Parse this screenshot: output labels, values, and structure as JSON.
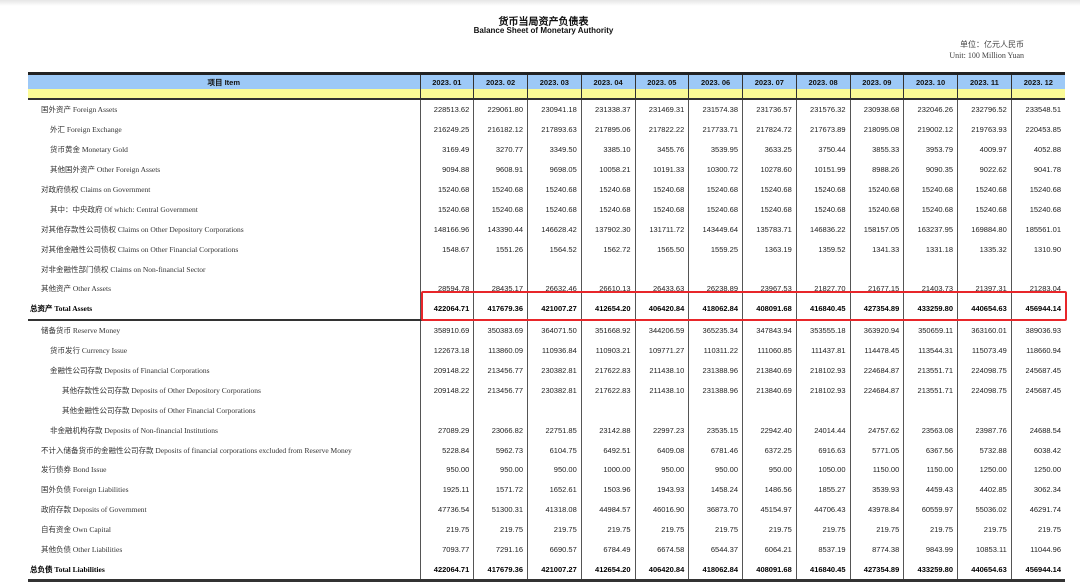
{
  "title_cn": "货币当局资产负债表",
  "title_en": "Balance Sheet of  Monetary Authority",
  "unit_cn": "单位：亿元人民币",
  "unit_en": "Unit: 100 Million Yuan",
  "header": {
    "item": "项目 Item",
    "months": [
      "2023. 01",
      "2023. 02",
      "2023. 03",
      "2023. 04",
      "2023. 05",
      "2023. 06",
      "2023. 07",
      "2023. 08",
      "2023. 09",
      "2023. 10",
      "2023. 11",
      "2023. 12"
    ]
  },
  "highlight_color": "#e8262a",
  "rows": [
    {
      "label": "国外资产  Foreign Assets",
      "level": 1,
      "values": [
        "228513.62",
        "229061.80",
        "230941.18",
        "231338.37",
        "231469.31",
        "231574.38",
        "231736.57",
        "231576.32",
        "230938.68",
        "232046.26",
        "232796.52",
        "233548.51"
      ]
    },
    {
      "label": "外汇  Foreign Exchange",
      "level": 2,
      "values": [
        "216249.25",
        "216182.12",
        "217893.63",
        "217895.06",
        "217822.22",
        "217733.71",
        "217824.72",
        "217673.89",
        "218095.08",
        "219002.12",
        "219763.93",
        "220453.85"
      ]
    },
    {
      "label": "货币黄金  Monetary Gold",
      "level": 2,
      "values": [
        "3169.49",
        "3270.77",
        "3349.50",
        "3385.10",
        "3455.76",
        "3539.95",
        "3633.25",
        "3750.44",
        "3855.33",
        "3953.79",
        "4009.97",
        "4052.88"
      ]
    },
    {
      "label": "其他国外资产  Other Foreign Assets",
      "level": 2,
      "values": [
        "9094.88",
        "9608.91",
        "9698.05",
        "10058.21",
        "10191.33",
        "10300.72",
        "10278.60",
        "10151.99",
        "8988.26",
        "9090.35",
        "9022.62",
        "9041.78"
      ]
    },
    {
      "label": "对政府债权  Claims on Government",
      "level": 1,
      "values": [
        "15240.68",
        "15240.68",
        "15240.68",
        "15240.68",
        "15240.68",
        "15240.68",
        "15240.68",
        "15240.68",
        "15240.68",
        "15240.68",
        "15240.68",
        "15240.68"
      ]
    },
    {
      "label": "其中：中央政府  Of which: Central Government",
      "level": 2,
      "values": [
        "15240.68",
        "15240.68",
        "15240.68",
        "15240.68",
        "15240.68",
        "15240.68",
        "15240.68",
        "15240.68",
        "15240.68",
        "15240.68",
        "15240.68",
        "15240.68"
      ]
    },
    {
      "label": "对其他存款性公司债权  Claims on Other Depository Corporations",
      "level": 1,
      "values": [
        "148166.96",
        "143390.44",
        "146628.42",
        "137902.30",
        "131711.72",
        "143449.64",
        "135783.71",
        "146836.22",
        "158157.05",
        "163237.95",
        "169884.80",
        "185561.01"
      ]
    },
    {
      "label": "对其他金融性公司债权  Claims on Other Financial Corporations",
      "level": 1,
      "values": [
        "1548.67",
        "1551.26",
        "1564.52",
        "1562.72",
        "1565.50",
        "1559.25",
        "1363.19",
        "1359.52",
        "1341.33",
        "1331.18",
        "1335.32",
        "1310.90"
      ]
    },
    {
      "label": "对非金融性部门债权  Claims on Non-financial Sector",
      "level": 1,
      "values": [
        "",
        "",
        "",
        "",
        "",
        "",
        "",
        "",
        "",
        "",
        "",
        ""
      ]
    },
    {
      "label": "其他资产  Other Assets",
      "level": 1,
      "values": [
        "28594.78",
        "28435.17",
        "26632.46",
        "26610.13",
        "26433.63",
        "26238.89",
        "23967.53",
        "21827.70",
        "21677.15",
        "21403.73",
        "21397.31",
        "21283.04"
      ]
    },
    {
      "label": "总资产  Total Assets",
      "level": 0,
      "total": "ta",
      "values": [
        "422064.71",
        "417679.36",
        "421007.27",
        "412654.20",
        "406420.84",
        "418062.84",
        "408091.68",
        "416840.45",
        "427354.89",
        "433259.80",
        "440654.63",
        "456944.14"
      ]
    },
    {
      "label": "储备货币  Reserve Money",
      "level": 1,
      "values": [
        "358910.69",
        "350383.69",
        "364071.50",
        "351668.92",
        "344206.59",
        "365235.34",
        "347843.94",
        "353555.18",
        "363920.94",
        "350659.11",
        "363160.01",
        "389036.93"
      ]
    },
    {
      "label": "货币发行  Currency Issue",
      "level": 2,
      "values": [
        "122673.18",
        "113860.09",
        "110936.84",
        "110903.21",
        "109771.27",
        "110311.22",
        "111060.85",
        "111437.81",
        "114478.45",
        "113544.31",
        "115073.49",
        "118660.94"
      ]
    },
    {
      "label": "金融性公司存款  Deposits of  Financial Corporations",
      "level": 2,
      "values": [
        "209148.22",
        "213456.77",
        "230382.81",
        "217622.83",
        "211438.10",
        "231388.96",
        "213840.69",
        "218102.93",
        "224684.87",
        "213551.71",
        "224098.75",
        "245687.45"
      ]
    },
    {
      "label": "其他存款性公司存款  Deposits of  Other Depository Corporations",
      "level": 3,
      "values": [
        "209148.22",
        "213456.77",
        "230382.81",
        "217622.83",
        "211438.10",
        "231388.96",
        "213840.69",
        "218102.93",
        "224684.87",
        "213551.71",
        "224098.75",
        "245687.45"
      ]
    },
    {
      "label": "其他金融性公司存款  Deposits of  Other Financial Corporations",
      "level": 3,
      "values": [
        "",
        "",
        "",
        "",
        "",
        "",
        "",
        "",
        "",
        "",
        "",
        ""
      ]
    },
    {
      "label": "非金融机构存款 Deposits of  Non-financial Institutions",
      "level": 2,
      "values": [
        "27089.29",
        "23066.82",
        "22751.85",
        "23142.88",
        "22997.23",
        "23535.15",
        "22942.40",
        "24014.44",
        "24757.62",
        "23563.08",
        "23987.76",
        "24688.54"
      ]
    },
    {
      "label": "不计入储备货币的金融性公司存款  Deposits of financial corporations excluded from Reserve Money",
      "level": 1,
      "values": [
        "5228.84",
        "5962.73",
        "6104.75",
        "6492.51",
        "6409.08",
        "6781.46",
        "6372.25",
        "6916.63",
        "5771.05",
        "6367.56",
        "5732.88",
        "6038.42"
      ]
    },
    {
      "label": "发行债券  Bond Issue",
      "level": 1,
      "values": [
        "950.00",
        "950.00",
        "950.00",
        "1000.00",
        "950.00",
        "950.00",
        "950.00",
        "1050.00",
        "1150.00",
        "1150.00",
        "1250.00",
        "1250.00"
      ]
    },
    {
      "label": "国外负债  Foreign Liabilities",
      "level": 1,
      "values": [
        "1925.11",
        "1571.72",
        "1652.61",
        "1503.96",
        "1943.93",
        "1458.24",
        "1486.56",
        "1855.27",
        "3539.93",
        "4459.43",
        "4402.85",
        "3062.34"
      ]
    },
    {
      "label": "政府存款  Deposits of Government",
      "level": 1,
      "values": [
        "47736.54",
        "51300.31",
        "41318.08",
        "44984.57",
        "46016.90",
        "36873.70",
        "45154.97",
        "44706.43",
        "43978.84",
        "60559.97",
        "55036.02",
        "46291.74"
      ]
    },
    {
      "label": "自有资金  Own Capital",
      "level": 1,
      "values": [
        "219.75",
        "219.75",
        "219.75",
        "219.75",
        "219.75",
        "219.75",
        "219.75",
        "219.75",
        "219.75",
        "219.75",
        "219.75",
        "219.75"
      ]
    },
    {
      "label": "其他负债  Other Liabilities",
      "level": 1,
      "values": [
        "7093.77",
        "7291.16",
        "6690.57",
        "6784.49",
        "6674.58",
        "6544.37",
        "6064.21",
        "8537.19",
        "8774.38",
        "9843.99",
        "10853.11",
        "11044.96"
      ]
    },
    {
      "label": "总负债  Total  Liabilities",
      "level": 0,
      "total": "tl",
      "values": [
        "422064.71",
        "417679.36",
        "421007.27",
        "412654.20",
        "406420.84",
        "418062.84",
        "408091.68",
        "416840.45",
        "427354.89",
        "433259.80",
        "440654.63",
        "456944.14"
      ]
    }
  ]
}
